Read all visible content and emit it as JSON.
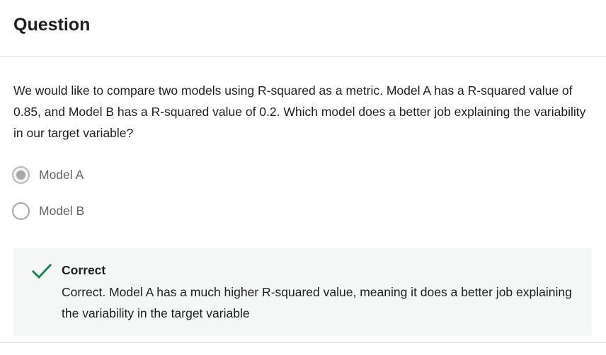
{
  "header": {
    "title": "Question"
  },
  "question": {
    "text": "We would like to compare two models using R-squared as a metric.  Model A has a R-squared value of 0.85, and Model B has a R-squared value of 0.2.  Which model does a better job explaining the variability in our target variable?"
  },
  "options": [
    {
      "label": "Model A",
      "selected": true
    },
    {
      "label": "Model B",
      "selected": false
    }
  ],
  "feedback": {
    "status": "Correct",
    "text": "Correct.  Model A has a much higher R-squared value, meaning it does a better job explaining the variability in the target variable",
    "icon": "checkmark-icon",
    "icon_color": "#1f8354",
    "background_color": "#f4f7f5"
  }
}
